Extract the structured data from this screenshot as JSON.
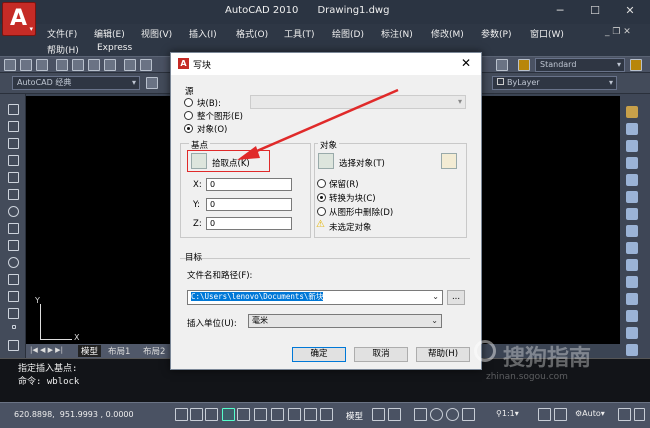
{
  "app": {
    "title": "AutoCAD 2010",
    "document": "Drawing1.dwg"
  },
  "menus": [
    {
      "label": "文件(F)"
    },
    {
      "label": "编辑(E)"
    },
    {
      "label": "视图(V)"
    },
    {
      "label": "插入(I)"
    },
    {
      "label": "格式(O)"
    },
    {
      "label": "工具(T)"
    },
    {
      "label": "绘图(D)"
    },
    {
      "label": "标注(N)"
    },
    {
      "label": "修改(M)"
    },
    {
      "label": "参数(P)"
    },
    {
      "label": "窗口(W)"
    }
  ],
  "menus2": [
    {
      "label": "帮助(H)"
    },
    {
      "label": "Express"
    }
  ],
  "toolbar": {
    "workspace": "AutoCAD 经典",
    "text_style": "Standard",
    "linetype": "ByLayer"
  },
  "tabs": {
    "model": "模型",
    "layout1": "布局1",
    "layout2": "布局2"
  },
  "command": {
    "line1": "指定插入基点:",
    "line2": "命令:  wblock"
  },
  "status": {
    "coords": "620.8898,  951.9993 , 0.0000",
    "model": "模型",
    "scale": "1:1",
    "auto": "Auto"
  },
  "watermark": {
    "text": "搜狗指南",
    "url": "zhinan.sogou.com"
  },
  "dialog": {
    "title": "写块",
    "source": {
      "heading": "源",
      "block": "块(B):",
      "entire_drawing": "整个图形(E)",
      "objects": "对象(O)",
      "selected": "objects"
    },
    "base_point": {
      "heading": "基点",
      "pick_label": "拾取点(K)",
      "x_label": "X:",
      "x": "0",
      "y_label": "Y:",
      "y": "0",
      "z_label": "Z:",
      "z": "0"
    },
    "objects": {
      "heading": "对象",
      "select_label": "选择对象(T)",
      "retain": "保留(R)",
      "convert": "转换为块(C)",
      "delete": "从图形中删除(D)",
      "selected": "convert",
      "warning": "未选定对象"
    },
    "target": {
      "heading": "目标",
      "path_label": "文件名和路径(F):",
      "path": "C:\\Users\\lenovo\\Documents\\新块",
      "browse": "...",
      "units_label": "插入单位(U):",
      "units": "毫米"
    },
    "buttons": {
      "ok": "确定",
      "cancel": "取消",
      "help": "帮助(H)"
    }
  },
  "colors": {
    "annotation_red": "#e02a2a",
    "accent_blue": "#0078d7"
  }
}
